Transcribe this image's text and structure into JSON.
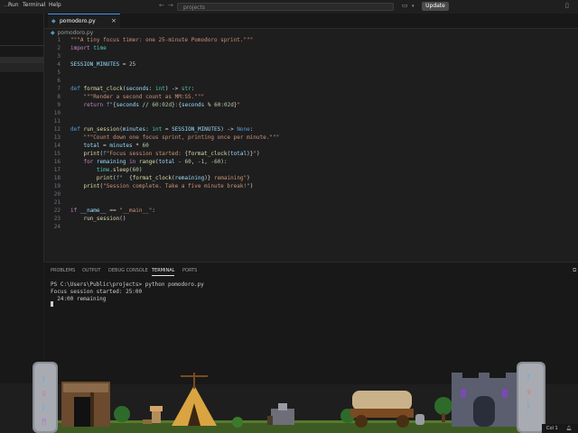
{
  "menu": {
    "items": [
      "Run",
      "Terminal",
      "Help"
    ]
  },
  "titlebar": {
    "back_icon": "arrow-left-icon",
    "forward_icon": "arrow-right-icon",
    "search_text": "projects",
    "update_label": "Update",
    "chat_icon": "chat-icon",
    "layout_icon": "layout-icon"
  },
  "tab": {
    "file_icon": "python-icon",
    "name": "pomodoro.py",
    "close_glyph": "×"
  },
  "breadcrumb": {
    "file": "pomodoro.py"
  },
  "editor": {
    "line_numbers": [
      "1",
      "2",
      "3",
      "4",
      "5",
      "6",
      "7",
      "8",
      "9",
      "10",
      "11",
      "12",
      "13",
      "14",
      "15",
      "16",
      "17",
      "18",
      "19",
      "20",
      "21",
      "22",
      "23",
      "24"
    ]
  },
  "panel": {
    "tabs": [
      "PROBLEMS",
      "OUTPUT",
      "DEBUG CONSOLE",
      "TERMINAL",
      "PORTS"
    ],
    "active_tab": "TERMINAL",
    "terminal_lines": [
      "PS C:\\Users\\Public\\projects> python pomodoro.py",
      "Focus session started: 25:00",
      "  24:00 remaining"
    ]
  },
  "statusbar": {
    "position": "Col 1"
  },
  "colors": {
    "accent": "#3794ff",
    "background": "#1e1e1e",
    "keyword": "#569cd6",
    "string": "#ce9178",
    "function": "#dcdcaa"
  }
}
